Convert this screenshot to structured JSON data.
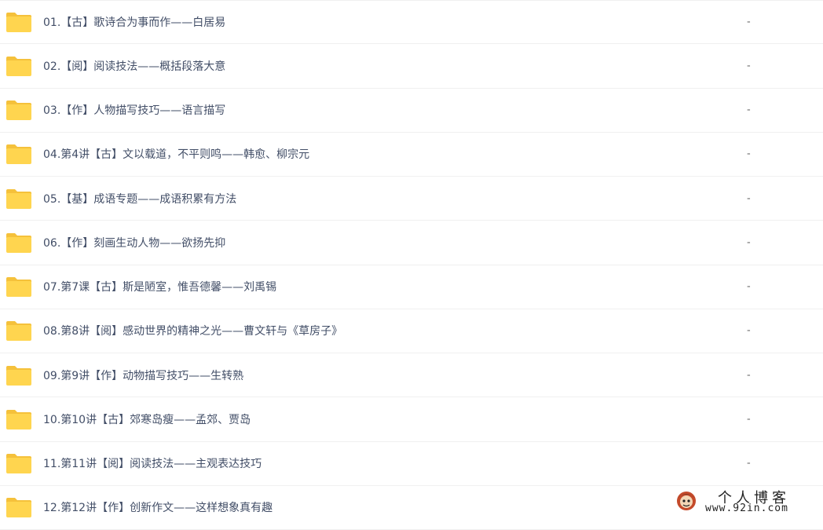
{
  "colors": {
    "folder_body": "#ffd54f",
    "folder_tab": "#f5c13b",
    "text": "#424e67",
    "divider": "#f0f0f0"
  },
  "rows": [
    {
      "name": "01.【古】歌诗合为事而作——白居易",
      "size": "-"
    },
    {
      "name": "02.【阅】阅读技法——概括段落大意",
      "size": "-"
    },
    {
      "name": "03.【作】人物描写技巧——语言描写",
      "size": "-"
    },
    {
      "name": "04.第4讲【古】文以载道，不平则鸣——韩愈、柳宗元",
      "size": "-"
    },
    {
      "name": "05.【基】成语专题——成语积累有方法",
      "size": "-"
    },
    {
      "name": "06.【作】刻画生动人物——欲扬先抑",
      "size": "-"
    },
    {
      "name": "07.第7课【古】斯是陋室，惟吾德馨——刘禹锡",
      "size": "-"
    },
    {
      "name": "08.第8讲【阅】感动世界的精神之光——曹文轩与《草房子》",
      "size": "-"
    },
    {
      "name": "09.第9讲【作】动物描写技巧——生转熟",
      "size": "-"
    },
    {
      "name": "10.第10讲【古】郊寒岛瘦——孟郊、贾岛",
      "size": "-"
    },
    {
      "name": "11.第11讲【阅】阅读技法——主观表达技巧",
      "size": "-"
    },
    {
      "name": "12.第12讲【作】创新作文——这样想象真有趣",
      "size": ""
    }
  ],
  "watermark": {
    "title": "个人博客",
    "url": "www.92in.com"
  }
}
